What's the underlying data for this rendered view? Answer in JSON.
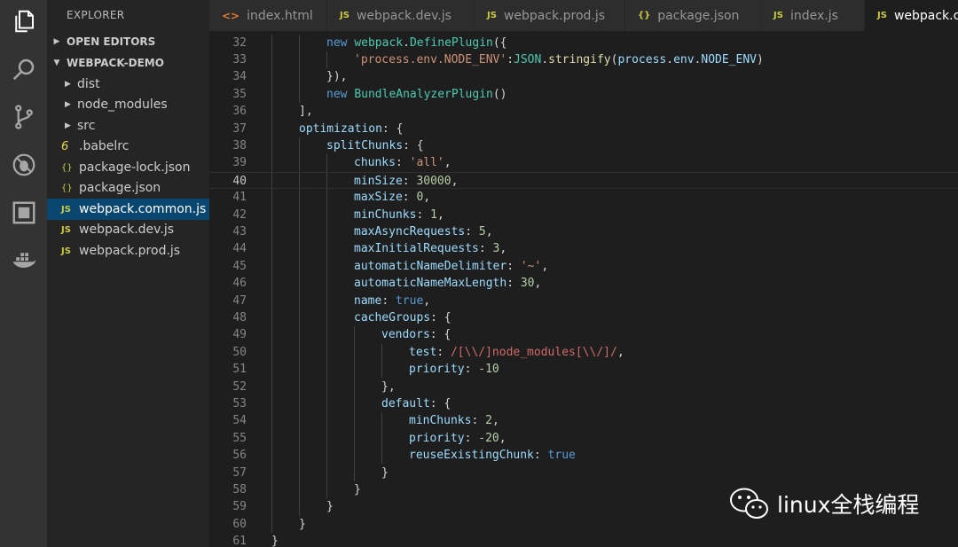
{
  "sidebar": {
    "title": "EXPLORER",
    "sections": [
      {
        "label": "OPEN EDITORS",
        "expanded": false
      },
      {
        "label": "WEBPACK-DEMO",
        "expanded": true
      }
    ],
    "tree": [
      {
        "label": "dist",
        "kind": "folder",
        "icon": ""
      },
      {
        "label": "node_modules",
        "kind": "folder",
        "icon": ""
      },
      {
        "label": "src",
        "kind": "folder",
        "icon": ""
      },
      {
        "label": ".babelrc",
        "kind": "file",
        "icon": "6"
      },
      {
        "label": "package-lock.json",
        "kind": "file",
        "icon": "{}"
      },
      {
        "label": "package.json",
        "kind": "file",
        "icon": "{}"
      },
      {
        "label": "webpack.common.js",
        "kind": "file",
        "icon": "JS",
        "selected": true
      },
      {
        "label": "webpack.dev.js",
        "kind": "file",
        "icon": "JS"
      },
      {
        "label": "webpack.prod.js",
        "kind": "file",
        "icon": "JS"
      }
    ]
  },
  "tabs": [
    {
      "label": "index.html",
      "icon": "<>"
    },
    {
      "label": "webpack.dev.js",
      "icon": "JS"
    },
    {
      "label": "webpack.prod.js",
      "icon": "JS"
    },
    {
      "label": "package.json",
      "icon": "{}"
    },
    {
      "label": "index.js",
      "icon": "JS"
    },
    {
      "label": "webpack.common.js",
      "icon": "JS",
      "active": true
    }
  ],
  "editor": {
    "current_line": "40",
    "lines": [
      {
        "n": "32",
        "indent": 2,
        "t": [
          [
            "kw",
            "new "
          ],
          [
            "cls",
            "webpack"
          ],
          [
            "",
            "."
          ],
          [
            "cls",
            "DefinePlugin"
          ],
          [
            "",
            "({"
          ]
        ]
      },
      {
        "n": "33",
        "indent": 3,
        "t": [
          [
            "str",
            "'process.env.NODE_ENV'"
          ],
          [
            "",
            ":"
          ],
          [
            "cls",
            "JSON"
          ],
          [
            "",
            "."
          ],
          [
            "fn",
            "stringify"
          ],
          [
            "",
            "("
          ],
          [
            "prop",
            "process"
          ],
          [
            "",
            "."
          ],
          [
            "prop",
            "env"
          ],
          [
            "",
            "."
          ],
          [
            "prop",
            "NODE_ENV"
          ],
          [
            "",
            ")"
          ]
        ]
      },
      {
        "n": "34",
        "indent": 2,
        "t": [
          [
            "",
            "}),"
          ]
        ]
      },
      {
        "n": "35",
        "indent": 2,
        "t": [
          [
            "kw",
            "new "
          ],
          [
            "cls",
            "BundleAnalyzerPlugin"
          ],
          [
            "",
            "()"
          ]
        ]
      },
      {
        "n": "36",
        "indent": 1,
        "t": [
          [
            "",
            "],"
          ]
        ]
      },
      {
        "n": "37",
        "indent": 1,
        "t": [
          [
            "prop",
            "optimization"
          ],
          [
            "",
            ": {"
          ]
        ]
      },
      {
        "n": "38",
        "indent": 2,
        "t": [
          [
            "prop",
            "splitChunks"
          ],
          [
            "",
            ": {"
          ]
        ]
      },
      {
        "n": "39",
        "indent": 3,
        "t": [
          [
            "prop",
            "chunks"
          ],
          [
            "",
            ": "
          ],
          [
            "str",
            "'all'"
          ],
          [
            "",
            ","
          ]
        ]
      },
      {
        "n": "40",
        "indent": 3,
        "t": [
          [
            "prop",
            "minSize"
          ],
          [
            "",
            ": "
          ],
          [
            "num",
            "30000"
          ],
          [
            "",
            ","
          ]
        ]
      },
      {
        "n": "41",
        "indent": 3,
        "t": [
          [
            "prop",
            "maxSize"
          ],
          [
            "",
            ": "
          ],
          [
            "num",
            "0"
          ],
          [
            "",
            ","
          ]
        ]
      },
      {
        "n": "42",
        "indent": 3,
        "t": [
          [
            "prop",
            "minChunks"
          ],
          [
            "",
            ": "
          ],
          [
            "num",
            "1"
          ],
          [
            "",
            ","
          ]
        ]
      },
      {
        "n": "43",
        "indent": 3,
        "t": [
          [
            "prop",
            "maxAsyncRequests"
          ],
          [
            "",
            ": "
          ],
          [
            "num",
            "5"
          ],
          [
            "",
            ","
          ]
        ]
      },
      {
        "n": "44",
        "indent": 3,
        "t": [
          [
            "prop",
            "maxInitialRequests"
          ],
          [
            "",
            ": "
          ],
          [
            "num",
            "3"
          ],
          [
            "",
            ","
          ]
        ]
      },
      {
        "n": "45",
        "indent": 3,
        "t": [
          [
            "prop",
            "automaticNameDelimiter"
          ],
          [
            "",
            ": "
          ],
          [
            "str",
            "'~'"
          ],
          [
            "",
            ","
          ]
        ]
      },
      {
        "n": "46",
        "indent": 3,
        "t": [
          [
            "prop",
            "automaticNameMaxLength"
          ],
          [
            "",
            ": "
          ],
          [
            "num",
            "30"
          ],
          [
            "",
            ","
          ]
        ]
      },
      {
        "n": "47",
        "indent": 3,
        "t": [
          [
            "prop",
            "name"
          ],
          [
            "",
            ": "
          ],
          [
            "kw",
            "true"
          ],
          [
            "",
            ","
          ]
        ]
      },
      {
        "n": "48",
        "indent": 3,
        "t": [
          [
            "prop",
            "cacheGroups"
          ],
          [
            "",
            ": {"
          ]
        ]
      },
      {
        "n": "49",
        "indent": 4,
        "t": [
          [
            "prop",
            "vendors"
          ],
          [
            "",
            ": {"
          ]
        ]
      },
      {
        "n": "50",
        "indent": 5,
        "t": [
          [
            "prop",
            "test"
          ],
          [
            "",
            ": "
          ],
          [
            "rx",
            "/[\\\\/]node_modules[\\\\/]/"
          ],
          [
            "",
            ","
          ]
        ]
      },
      {
        "n": "51",
        "indent": 5,
        "t": [
          [
            "prop",
            "priority"
          ],
          [
            "",
            ": "
          ],
          [
            "num",
            "-10"
          ]
        ]
      },
      {
        "n": "52",
        "indent": 4,
        "t": [
          [
            "",
            "},"
          ]
        ]
      },
      {
        "n": "53",
        "indent": 4,
        "t": [
          [
            "prop",
            "default"
          ],
          [
            "",
            ": {"
          ]
        ]
      },
      {
        "n": "54",
        "indent": 5,
        "t": [
          [
            "prop",
            "minChunks"
          ],
          [
            "",
            ": "
          ],
          [
            "num",
            "2"
          ],
          [
            "",
            ","
          ]
        ]
      },
      {
        "n": "55",
        "indent": 5,
        "t": [
          [
            "prop",
            "priority"
          ],
          [
            "",
            ": "
          ],
          [
            "num",
            "-20"
          ],
          [
            "",
            ","
          ]
        ]
      },
      {
        "n": "56",
        "indent": 5,
        "t": [
          [
            "prop",
            "reuseExistingChunk"
          ],
          [
            "",
            ": "
          ],
          [
            "kw",
            "true"
          ]
        ]
      },
      {
        "n": "57",
        "indent": 4,
        "t": [
          [
            "",
            "}"
          ]
        ]
      },
      {
        "n": "58",
        "indent": 3,
        "t": [
          [
            "",
            "}"
          ]
        ]
      },
      {
        "n": "59",
        "indent": 2,
        "t": [
          [
            "",
            "}"
          ]
        ]
      },
      {
        "n": "60",
        "indent": 1,
        "t": [
          [
            "",
            "}"
          ]
        ]
      },
      {
        "n": "61",
        "indent": 0,
        "t": [
          [
            "",
            "}"
          ]
        ]
      }
    ]
  },
  "watermark": {
    "text": "linux全栈编程",
    "icon": "wechat-icon"
  },
  "colors": {
    "activity_bar": "#333333",
    "sidebar": "#252526",
    "editor": "#1e1e1e",
    "selection": "#094771"
  }
}
